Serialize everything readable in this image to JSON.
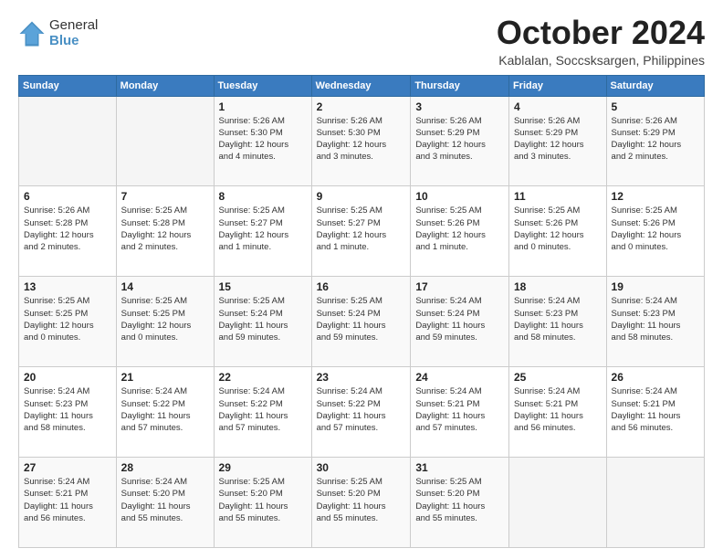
{
  "logo": {
    "general": "General",
    "blue": "Blue"
  },
  "header": {
    "month": "October 2024",
    "location": "Kablalan, Soccsksargen, Philippines"
  },
  "weekdays": [
    "Sunday",
    "Monday",
    "Tuesday",
    "Wednesday",
    "Thursday",
    "Friday",
    "Saturday"
  ],
  "weeks": [
    [
      {
        "day": "",
        "detail": ""
      },
      {
        "day": "",
        "detail": ""
      },
      {
        "day": "1",
        "detail": "Sunrise: 5:26 AM\nSunset: 5:30 PM\nDaylight: 12 hours\nand 4 minutes."
      },
      {
        "day": "2",
        "detail": "Sunrise: 5:26 AM\nSunset: 5:30 PM\nDaylight: 12 hours\nand 3 minutes."
      },
      {
        "day": "3",
        "detail": "Sunrise: 5:26 AM\nSunset: 5:29 PM\nDaylight: 12 hours\nand 3 minutes."
      },
      {
        "day": "4",
        "detail": "Sunrise: 5:26 AM\nSunset: 5:29 PM\nDaylight: 12 hours\nand 3 minutes."
      },
      {
        "day": "5",
        "detail": "Sunrise: 5:26 AM\nSunset: 5:29 PM\nDaylight: 12 hours\nand 2 minutes."
      }
    ],
    [
      {
        "day": "6",
        "detail": "Sunrise: 5:26 AM\nSunset: 5:28 PM\nDaylight: 12 hours\nand 2 minutes."
      },
      {
        "day": "7",
        "detail": "Sunrise: 5:25 AM\nSunset: 5:28 PM\nDaylight: 12 hours\nand 2 minutes."
      },
      {
        "day": "8",
        "detail": "Sunrise: 5:25 AM\nSunset: 5:27 PM\nDaylight: 12 hours\nand 1 minute."
      },
      {
        "day": "9",
        "detail": "Sunrise: 5:25 AM\nSunset: 5:27 PM\nDaylight: 12 hours\nand 1 minute."
      },
      {
        "day": "10",
        "detail": "Sunrise: 5:25 AM\nSunset: 5:26 PM\nDaylight: 12 hours\nand 1 minute."
      },
      {
        "day": "11",
        "detail": "Sunrise: 5:25 AM\nSunset: 5:26 PM\nDaylight: 12 hours\nand 0 minutes."
      },
      {
        "day": "12",
        "detail": "Sunrise: 5:25 AM\nSunset: 5:26 PM\nDaylight: 12 hours\nand 0 minutes."
      }
    ],
    [
      {
        "day": "13",
        "detail": "Sunrise: 5:25 AM\nSunset: 5:25 PM\nDaylight: 12 hours\nand 0 minutes."
      },
      {
        "day": "14",
        "detail": "Sunrise: 5:25 AM\nSunset: 5:25 PM\nDaylight: 12 hours\nand 0 minutes."
      },
      {
        "day": "15",
        "detail": "Sunrise: 5:25 AM\nSunset: 5:24 PM\nDaylight: 11 hours\nand 59 minutes."
      },
      {
        "day": "16",
        "detail": "Sunrise: 5:25 AM\nSunset: 5:24 PM\nDaylight: 11 hours\nand 59 minutes."
      },
      {
        "day": "17",
        "detail": "Sunrise: 5:24 AM\nSunset: 5:24 PM\nDaylight: 11 hours\nand 59 minutes."
      },
      {
        "day": "18",
        "detail": "Sunrise: 5:24 AM\nSunset: 5:23 PM\nDaylight: 11 hours\nand 58 minutes."
      },
      {
        "day": "19",
        "detail": "Sunrise: 5:24 AM\nSunset: 5:23 PM\nDaylight: 11 hours\nand 58 minutes."
      }
    ],
    [
      {
        "day": "20",
        "detail": "Sunrise: 5:24 AM\nSunset: 5:23 PM\nDaylight: 11 hours\nand 58 minutes."
      },
      {
        "day": "21",
        "detail": "Sunrise: 5:24 AM\nSunset: 5:22 PM\nDaylight: 11 hours\nand 57 minutes."
      },
      {
        "day": "22",
        "detail": "Sunrise: 5:24 AM\nSunset: 5:22 PM\nDaylight: 11 hours\nand 57 minutes."
      },
      {
        "day": "23",
        "detail": "Sunrise: 5:24 AM\nSunset: 5:22 PM\nDaylight: 11 hours\nand 57 minutes."
      },
      {
        "day": "24",
        "detail": "Sunrise: 5:24 AM\nSunset: 5:21 PM\nDaylight: 11 hours\nand 57 minutes."
      },
      {
        "day": "25",
        "detail": "Sunrise: 5:24 AM\nSunset: 5:21 PM\nDaylight: 11 hours\nand 56 minutes."
      },
      {
        "day": "26",
        "detail": "Sunrise: 5:24 AM\nSunset: 5:21 PM\nDaylight: 11 hours\nand 56 minutes."
      }
    ],
    [
      {
        "day": "27",
        "detail": "Sunrise: 5:24 AM\nSunset: 5:21 PM\nDaylight: 11 hours\nand 56 minutes."
      },
      {
        "day": "28",
        "detail": "Sunrise: 5:24 AM\nSunset: 5:20 PM\nDaylight: 11 hours\nand 55 minutes."
      },
      {
        "day": "29",
        "detail": "Sunrise: 5:25 AM\nSunset: 5:20 PM\nDaylight: 11 hours\nand 55 minutes."
      },
      {
        "day": "30",
        "detail": "Sunrise: 5:25 AM\nSunset: 5:20 PM\nDaylight: 11 hours\nand 55 minutes."
      },
      {
        "day": "31",
        "detail": "Sunrise: 5:25 AM\nSunset: 5:20 PM\nDaylight: 11 hours\nand 55 minutes."
      },
      {
        "day": "",
        "detail": ""
      },
      {
        "day": "",
        "detail": ""
      }
    ]
  ]
}
